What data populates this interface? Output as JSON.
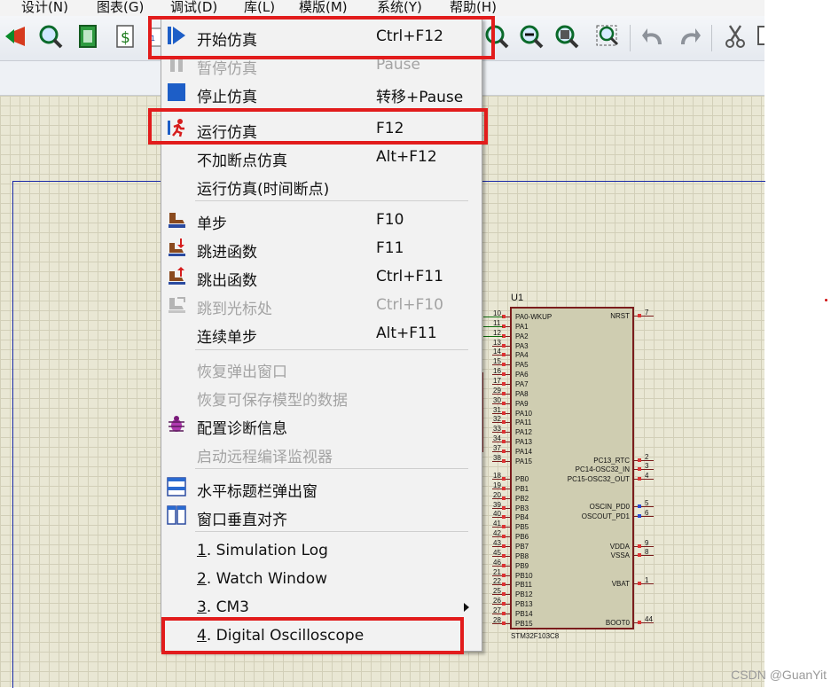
{
  "menubar": {
    "items": [
      "设计(N)",
      "图表(G)",
      "调试(D)",
      "库(L)",
      "模版(M)",
      "系统(Y)",
      "帮助(H)"
    ]
  },
  "toolbar": {
    "icons": [
      "component-icon",
      "zoom-search-icon",
      "netlist-icon",
      "bom-icon",
      "zoom-in-icon",
      "zoom-out-icon",
      "zoom-all-icon",
      "zoom-area-icon",
      "undo-icon",
      "redo-icon",
      "cut-icon",
      "copy-icon"
    ]
  },
  "debug_menu": {
    "items": [
      {
        "label": "开始仿真",
        "shortcut": "Ctrl+F12",
        "enabled": true,
        "icon": "play-icon",
        "highlighted": true
      },
      {
        "label": "暂停仿真",
        "shortcut": "Pause",
        "enabled": false,
        "icon": "pause-icon"
      },
      {
        "label": "停止仿真",
        "shortcut": "转移+Pause",
        "enabled": true,
        "icon": "stop-icon"
      },
      {
        "label": "运行仿真",
        "shortcut": "F12",
        "enabled": true,
        "icon": "run-icon",
        "highlighted": true
      },
      {
        "label": "不加断点仿真",
        "shortcut": "Alt+F12",
        "enabled": true
      },
      {
        "label": "运行仿真(时间断点)",
        "shortcut": "",
        "enabled": true
      },
      {
        "label": "单步",
        "shortcut": "F10",
        "enabled": true,
        "icon": "step-icon"
      },
      {
        "label": "跳进函数",
        "shortcut": "F11",
        "enabled": true,
        "icon": "step-into-icon"
      },
      {
        "label": "跳出函数",
        "shortcut": "Ctrl+F11",
        "enabled": true,
        "icon": "step-out-icon"
      },
      {
        "label": "跳到光标处",
        "shortcut": "Ctrl+F10",
        "enabled": false,
        "icon": "run-to-cursor-icon"
      },
      {
        "label": "连续单步",
        "shortcut": "Alt+F11",
        "enabled": true
      },
      {
        "label": "恢复弹出窗口",
        "shortcut": "",
        "enabled": false
      },
      {
        "label": "恢复可保存模型的数据",
        "shortcut": "",
        "enabled": false
      },
      {
        "label": "配置诊断信息",
        "shortcut": "",
        "enabled": true,
        "icon": "bug-icon"
      },
      {
        "label": "启动远程编译监视器",
        "shortcut": "",
        "enabled": false
      },
      {
        "label": "水平标题栏弹出窗",
        "shortcut": "",
        "enabled": true,
        "icon": "tile-horizontal-icon"
      },
      {
        "label": "窗口垂直对齐",
        "shortcut": "",
        "enabled": true,
        "icon": "tile-vertical-icon"
      },
      {
        "num": "1",
        "label": ". Simulation Log",
        "enabled": true
      },
      {
        "num": "2",
        "label": ". Watch Window",
        "enabled": true
      },
      {
        "num": "3",
        "label": ". CM3",
        "enabled": true,
        "submenu": true
      },
      {
        "num": "4",
        "label": ". Digital Oscilloscope",
        "enabled": true,
        "highlighted": true
      }
    ]
  },
  "chip": {
    "ref": "U1",
    "model": "STM32F103C8",
    "left_pins": [
      {
        "num": "10",
        "name": "PA0-WKUP"
      },
      {
        "num": "11",
        "name": "PA1"
      },
      {
        "num": "12",
        "name": "PA2"
      },
      {
        "num": "13",
        "name": "PA3"
      },
      {
        "num": "14",
        "name": "PA4"
      },
      {
        "num": "15",
        "name": "PA5"
      },
      {
        "num": "16",
        "name": "PA6"
      },
      {
        "num": "17",
        "name": "PA7"
      },
      {
        "num": "29",
        "name": "PA8"
      },
      {
        "num": "30",
        "name": "PA9"
      },
      {
        "num": "31",
        "name": "PA10"
      },
      {
        "num": "32",
        "name": "PA11"
      },
      {
        "num": "33",
        "name": "PA12"
      },
      {
        "num": "34",
        "name": "PA13"
      },
      {
        "num": "37",
        "name": "PA14"
      },
      {
        "num": "38",
        "name": "PA15"
      },
      {
        "num": "18",
        "name": "PB0"
      },
      {
        "num": "19",
        "name": "PB1"
      },
      {
        "num": "20",
        "name": "PB2"
      },
      {
        "num": "39",
        "name": "PB3"
      },
      {
        "num": "40",
        "name": "PB4"
      },
      {
        "num": "41",
        "name": "PB5"
      },
      {
        "num": "42",
        "name": "PB6"
      },
      {
        "num": "43",
        "name": "PB7"
      },
      {
        "num": "45",
        "name": "PB8"
      },
      {
        "num": "46",
        "name": "PB9"
      },
      {
        "num": "21",
        "name": "PB10"
      },
      {
        "num": "22",
        "name": "PB11"
      },
      {
        "num": "25",
        "name": "PB12"
      },
      {
        "num": "26",
        "name": "PB13"
      },
      {
        "num": "27",
        "name": "PB14"
      },
      {
        "num": "28",
        "name": "PB15"
      }
    ],
    "right_pins": [
      {
        "num": "7",
        "name": "NRST"
      },
      {
        "num": "2",
        "name": "PC13_RTC"
      },
      {
        "num": "3",
        "name": "PC14-OSC32_IN"
      },
      {
        "num": "4",
        "name": "PC15-OSC32_OUT"
      },
      {
        "num": "5",
        "name": "OSCIN_PD0"
      },
      {
        "num": "6",
        "name": "OSCOUT_PD1"
      },
      {
        "num": "9",
        "name": "VDDA"
      },
      {
        "num": "8",
        "name": "VSSA"
      },
      {
        "num": "1",
        "name": "VBAT"
      },
      {
        "num": "44",
        "name": "BOOT0"
      }
    ]
  },
  "watermark": "CSDN @GuanYit"
}
